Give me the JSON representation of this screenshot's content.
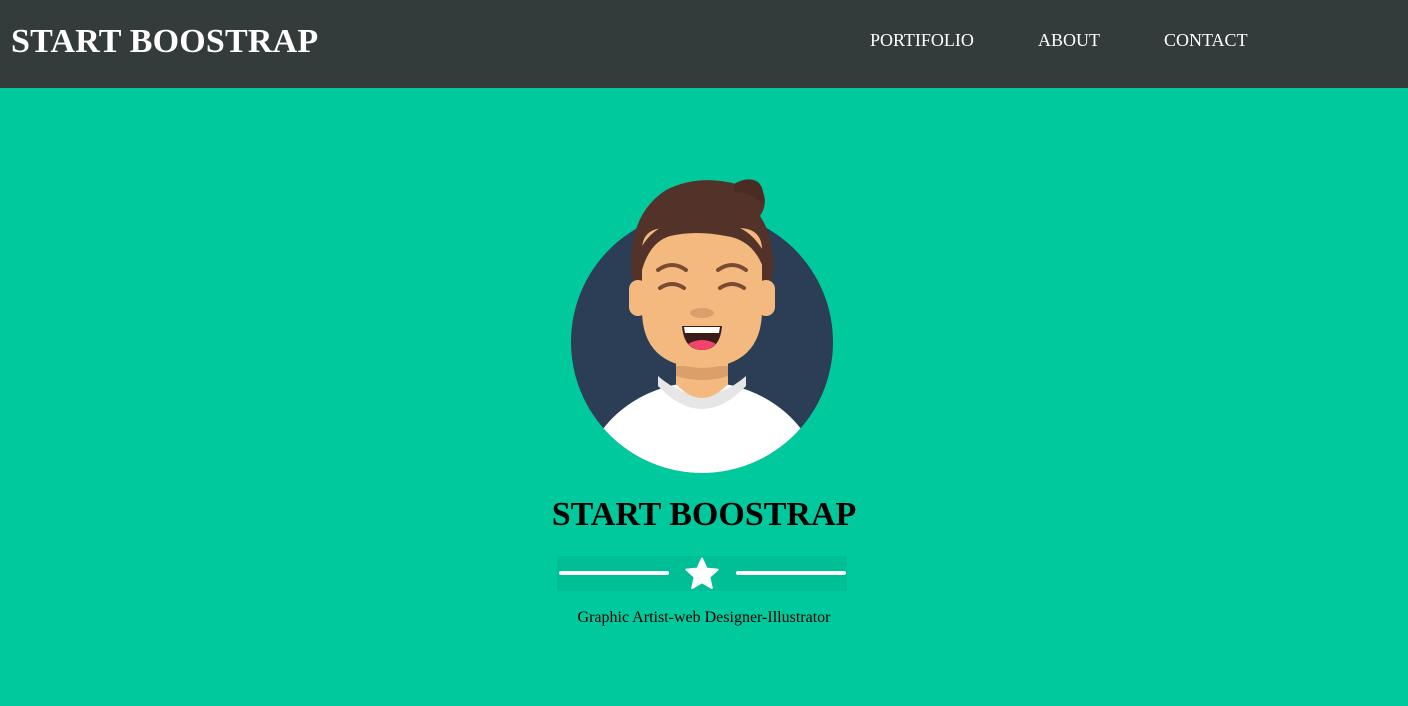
{
  "navbar": {
    "brand": "START BOOSTRAP",
    "links": [
      {
        "label": "PORTIFOLIO"
      },
      {
        "label": "ABOUT"
      },
      {
        "label": "CONTACT"
      }
    ]
  },
  "hero": {
    "avatar_icon": "smiling-man-avatar-icon",
    "title": "START BOOSTRAP",
    "divider_icon": "star-icon",
    "subtitle": "Graphic Artist-web Designer-Illustrator"
  },
  "colors": {
    "background": "#00c99e",
    "navbar": "#343b3b",
    "avatar_circle": "#2b3e55",
    "text_light": "#ffffff",
    "text_dark": "#000000"
  }
}
